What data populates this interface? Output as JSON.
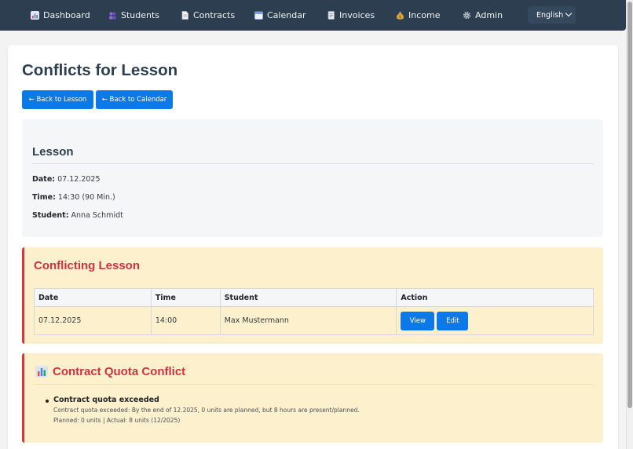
{
  "nav": {
    "items": [
      {
        "label": "Dashboard",
        "icon": "chart-icon",
        "color": "#7aa7d9"
      },
      {
        "label": "Students",
        "icon": "students-icon",
        "color": "#8e6bd6"
      },
      {
        "label": "Contracts",
        "icon": "document-icon",
        "color": "#e8e8e8"
      },
      {
        "label": "Calendar",
        "icon": "calendar-icon",
        "color": "#9bb6e8"
      },
      {
        "label": "Invoices",
        "icon": "invoice-icon",
        "color": "#c7cdd6"
      },
      {
        "label": "Income",
        "icon": "money-bag-icon",
        "color": "#e0a43b"
      },
      {
        "label": "Admin",
        "icon": "gear-icon",
        "color": "#c9ced6"
      }
    ],
    "language": "English"
  },
  "page": {
    "title": "Conflicts for Lesson",
    "back_to_lesson": "← Back to Lesson",
    "back_to_calendar": "← Back to Calendar"
  },
  "lesson": {
    "heading": "Lesson",
    "date_label": "Date:",
    "date_value": "07.12.2025",
    "time_label": "Time:",
    "time_value": "14:30 (90 Min.)",
    "student_label": "Student:",
    "student_value": "Anna Schmidt"
  },
  "conflicting_lesson": {
    "heading": "Conflicting Lesson",
    "columns": [
      "Date",
      "Time",
      "Student",
      "Action"
    ],
    "rows": [
      {
        "date": "07.12.2025",
        "time": "14:00",
        "student": "Max Mustermann",
        "view_label": "View",
        "edit_label": "Edit"
      }
    ]
  },
  "quota_conflict": {
    "heading": "Contract Quota Conflict",
    "icon": "bar-chart-icon",
    "item_title": "Contract quota exceeded",
    "item_detail": "Contract quota exceeded: By the end of 12.2025, 0 units are planned, but 8 hours are present/planned.",
    "item_summary": "Planned: 0 units | Actual: 8 units (12/2025)"
  },
  "colors": {
    "navbar": "#2c3e50",
    "primary": "#0b79e8",
    "conflict_bg": "#fdf0cd",
    "conflict_accent": "#d9363e",
    "conflict_heading": "#cc3340"
  }
}
